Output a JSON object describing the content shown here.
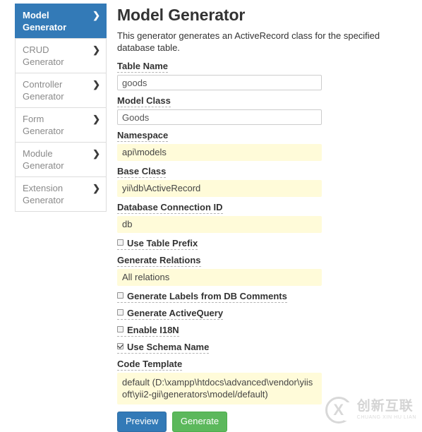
{
  "sidebar": {
    "items": [
      {
        "label": "Model Generator",
        "active": true,
        "icon": "chevron-right-icon"
      },
      {
        "label": "CRUD Generator",
        "active": false,
        "icon": "chevron-right-icon"
      },
      {
        "label": "Controller Generator",
        "active": false,
        "icon": "chevron-right-icon"
      },
      {
        "label": "Form Generator",
        "active": false,
        "icon": "chevron-right-icon"
      },
      {
        "label": "Module Generator",
        "active": false,
        "icon": "chevron-right-icon"
      },
      {
        "label": "Extension Generator",
        "active": false,
        "icon": "chevron-right-icon"
      }
    ]
  },
  "main": {
    "title": "Model Generator",
    "description": "This generator generates an ActiveRecord class for the specified database table.",
    "fields": [
      {
        "label": "Table Name",
        "value": "goods",
        "style": "plain"
      },
      {
        "label": "Model Class",
        "value": "Goods",
        "style": "plain"
      },
      {
        "label": "Namespace",
        "value": "api\\models",
        "style": "autofill"
      },
      {
        "label": "Base Class",
        "value": "yii\\db\\ActiveRecord",
        "style": "autofill"
      },
      {
        "label": "Database Connection ID",
        "value": "db",
        "style": "autofill"
      }
    ],
    "checkbox_use_table_prefix": {
      "label": "Use Table Prefix",
      "checked": false
    },
    "generate_relations": {
      "label": "Generate Relations",
      "value": "All relations"
    },
    "checkbox_generate_labels": {
      "label": "Generate Labels from DB Comments",
      "checked": false
    },
    "checkbox_generate_activequery": {
      "label": "Generate ActiveQuery",
      "checked": false
    },
    "checkbox_enable_i18n": {
      "label": "Enable I18N",
      "checked": false
    },
    "checkbox_use_schema_name": {
      "label": "Use Schema Name",
      "checked": true
    },
    "code_template": {
      "label": "Code Template",
      "value": "default (D:\\xampp\\htdocs\\advanced\\vendor\\yiisoft\\yii2-gii\\generators\\model/default)"
    },
    "buttons": {
      "preview": "Preview",
      "generate": "Generate"
    }
  },
  "watermark": {
    "chinese": "创新互联",
    "pinyin": "CHUANG XIN HU LIAN"
  },
  "colors": {
    "primary": "#337ab7",
    "success": "#5cb85c",
    "autofill": "#fffbd9",
    "border": "#dddddd"
  }
}
